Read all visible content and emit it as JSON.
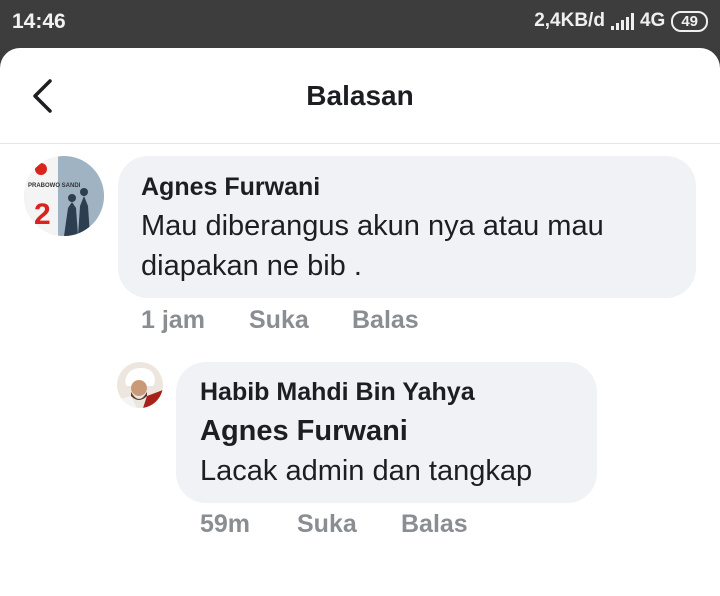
{
  "status_bar": {
    "time": "14:46",
    "net_speed": "2,4KB/d",
    "network": "4G",
    "battery": "49"
  },
  "header": {
    "title": "Balasan",
    "back_icon": "chevron-left-icon"
  },
  "comment": {
    "author": "Agnes Furwani",
    "text_line1": "Mau diberangus akun nya atau mau",
    "text_line2": "diapakan ne bib .",
    "time": "1 jam",
    "like": "Suka",
    "reply": "Balas",
    "avatar_badge": "PRABOWO SANDI",
    "avatar_number": "2"
  },
  "reply": {
    "author": "Habib Mahdi Bin Yahya",
    "mention": "Agnes Furwani",
    "text": "Lacak admin dan tangkap",
    "time": "59m",
    "like": "Suka",
    "reply": "Balas"
  },
  "colors": {
    "bubble": "#f0f2f5",
    "meta": "#8a8d91",
    "text": "#1c1e21",
    "status_bar": "#3d3d3d"
  }
}
